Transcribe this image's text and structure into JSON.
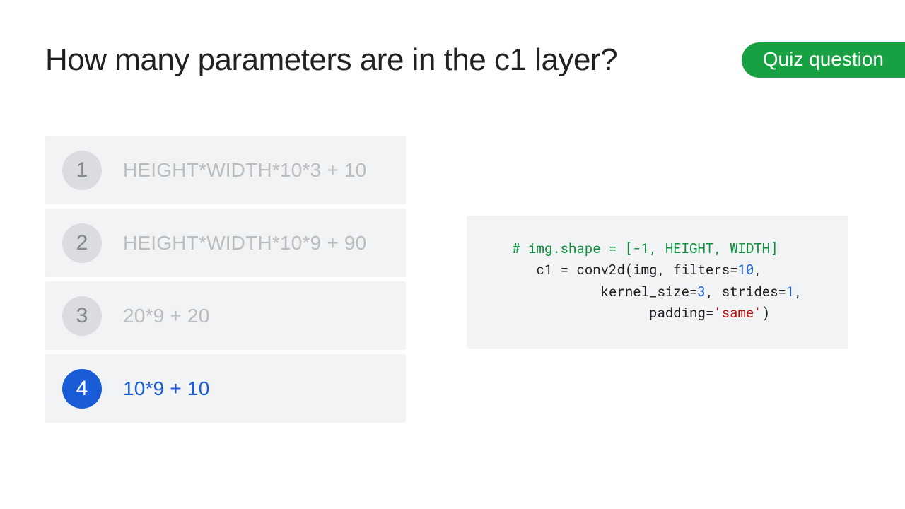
{
  "badge": "Quiz question",
  "title": "How many parameters are in the c1 layer?",
  "options": [
    {
      "num": "1",
      "text": "HEIGHT*WIDTH*10*3 + 10",
      "selected": false
    },
    {
      "num": "2",
      "text": "HEIGHT*WIDTH*10*9 + 90",
      "selected": false
    },
    {
      "num": "3",
      "text": "20*9 + 20",
      "selected": false
    },
    {
      "num": "4",
      "text": "10*9 + 10",
      "selected": true
    }
  ],
  "code": {
    "indent1": "   ",
    "comment": "# img.shape = [-1, HEIGHT, WIDTH]",
    "indent2": "      ",
    "l2a": "c1 = conv2d(img, filters=",
    "n10": "10",
    "l2b": ",",
    "indent3": "              ",
    "l3a": "kernel_size=",
    "n3": "3",
    "l3b": ", strides=",
    "n1": "1",
    "l3c": ",",
    "indent4": "                    ",
    "l4a": "padding=",
    "same": "'same'",
    "l4b": ")"
  }
}
